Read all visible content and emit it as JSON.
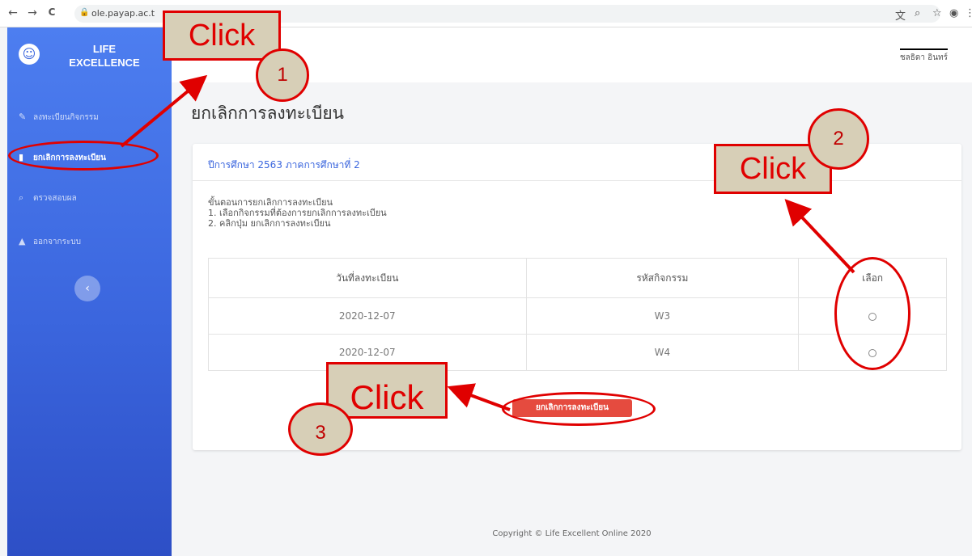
{
  "browser": {
    "back_icon": "←",
    "forward_icon": "→",
    "reload_icon": "C",
    "lock_icon": "🔒",
    "url": "ole.payap.ac.t",
    "translate_icon": "文",
    "zoom_icon": "⌕",
    "star_icon": "☆",
    "account_icon": "◉",
    "menu_icon": "⋮"
  },
  "sidebar": {
    "logo_glyph": "☺",
    "brand_line1": "LIFE",
    "brand_line2": "EXCELLENCE",
    "items": [
      {
        "icon": "✎",
        "label": "ลงทะเบียนกิจกรรม"
      },
      {
        "icon": "▮",
        "label": "ยกเลิกการลงทะเบียน"
      },
      {
        "icon": "⌕",
        "label": "ตรวจสอบผล"
      },
      {
        "icon": "▲",
        "label": "ออกจากระบบ"
      }
    ],
    "collapse_icon": "‹"
  },
  "header": {
    "user_name": "ชลธิดา อินทร์"
  },
  "page": {
    "title": "ยกเลิกการลงทะเบียน",
    "card_title": "ปีการศึกษา 2563 ภาคการศึกษาที่ 2",
    "steps": [
      "ขั้นตอนการยกเลิกการลงทะเบียน",
      "1. เลือกกิจกรรมที่ต้องการยกเลิกการลงทะเบียน",
      "2. คลิกปุ่ม ยกเลิกการลงทะเบียน"
    ],
    "table": {
      "headers": [
        "วันที่ลงทะเบียน",
        "รหัสกิจกรรม",
        "เลือก"
      ],
      "rows": [
        {
          "date": "2020-12-07",
          "code": "W3"
        },
        {
          "date": "2020-12-07",
          "code": "W4"
        }
      ]
    },
    "cancel_button": "ยกเลิกการลงทะเบียน"
  },
  "footer": {
    "copyright": "Copyright © Life Excellent Online 2020"
  },
  "annotations": {
    "click_label": "Click",
    "step1": "1",
    "step2": "2",
    "step3": "3",
    "color": "#e00000"
  }
}
